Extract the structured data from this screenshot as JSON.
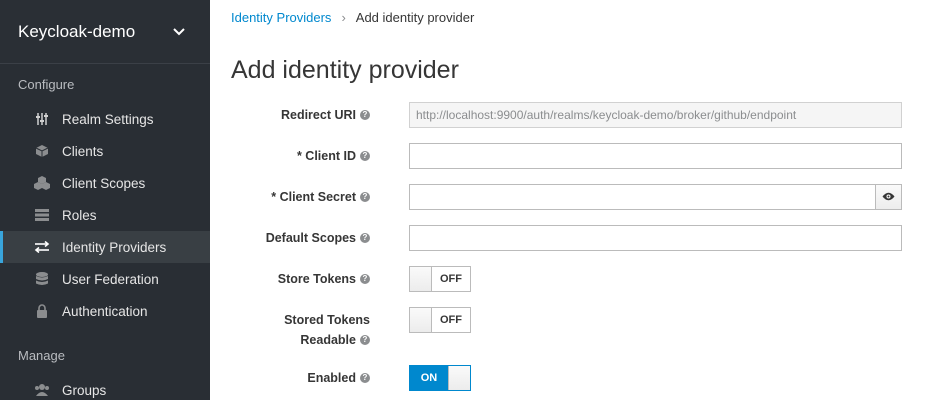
{
  "sidebar": {
    "realm": "Keycloak-demo",
    "configure_label": "Configure",
    "manage_label": "Manage",
    "items": [
      {
        "label": "Realm Settings",
        "icon": "sliders-icon"
      },
      {
        "label": "Clients",
        "icon": "cube-icon"
      },
      {
        "label": "Client Scopes",
        "icon": "cubes-icon"
      },
      {
        "label": "Roles",
        "icon": "list-icon"
      },
      {
        "label": "Identity Providers",
        "icon": "exchange-icon",
        "active": true
      },
      {
        "label": "User Federation",
        "icon": "database-icon"
      },
      {
        "label": "Authentication",
        "icon": "lock-icon"
      }
    ],
    "manage_items": [
      {
        "label": "Groups",
        "icon": "users-icon"
      }
    ]
  },
  "breadcrumb": {
    "parent": "Identity Providers",
    "separator": "›",
    "current": "Add identity provider"
  },
  "page_title": "Add identity provider",
  "form": {
    "redirect_uri": {
      "label": "Redirect URI",
      "value": "http://localhost:9900/auth/realms/keycloak-demo/broker/github/endpoint"
    },
    "client_id": {
      "label": "* Client ID",
      "value": ""
    },
    "client_secret": {
      "label": "* Client Secret",
      "value": ""
    },
    "default_scopes": {
      "label": "Default Scopes",
      "value": ""
    },
    "store_tokens": {
      "label": "Store Tokens",
      "state": "OFF"
    },
    "stored_tokens_readable": {
      "label_line1": "Stored Tokens",
      "label_line2": "Readable",
      "state": "OFF"
    },
    "enabled": {
      "label": "Enabled",
      "state": "ON"
    }
  },
  "colors": {
    "accent": "#0088ce",
    "sidebar_bg": "#292e34",
    "active_bar": "#39a5dc"
  }
}
